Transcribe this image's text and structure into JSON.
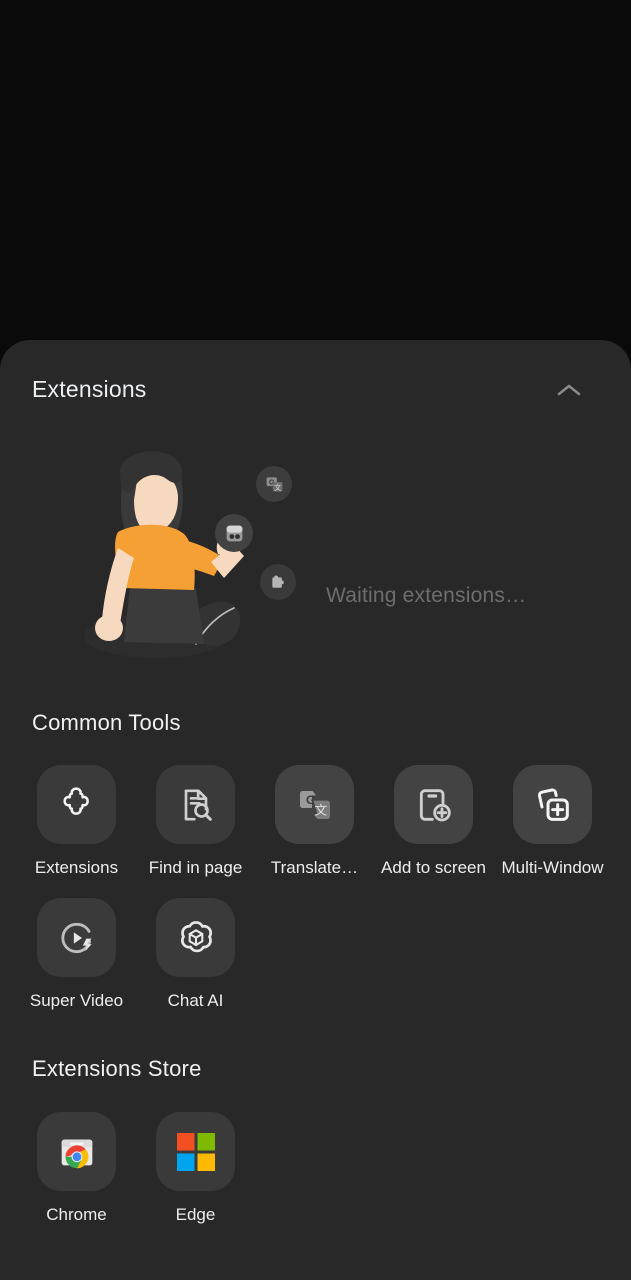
{
  "panel": {
    "extensions_header": {
      "title": "Extensions",
      "collapse_icon": "chevron-up-icon"
    },
    "illustration": {
      "alt": "person-reaching-for-extension-icons",
      "status_text": "Waiting extensions…",
      "floating_icons": [
        {
          "name": "translate-chip-icon"
        },
        {
          "name": "bookmark-chip-icon"
        },
        {
          "name": "puzzle-chip-icon"
        }
      ]
    },
    "common_tools": {
      "title": "Common Tools",
      "items": [
        {
          "label": "Extensions",
          "icon": "puzzle-piece-icon"
        },
        {
          "label": "Find in page",
          "icon": "document-search-icon"
        },
        {
          "label": "Translate…",
          "icon": "google-translate-icon"
        },
        {
          "label": "Add to screen",
          "icon": "add-to-home-screen-icon"
        },
        {
          "label": "Multi-Window",
          "icon": "multi-window-add-icon"
        },
        {
          "label": "Super Video",
          "icon": "video-boost-icon"
        },
        {
          "label": "Chat AI",
          "icon": "openai-logo-icon"
        }
      ]
    },
    "extensions_store": {
      "title": "Extensions Store",
      "items": [
        {
          "label": "Chrome",
          "icon": "chrome-web-store-icon"
        },
        {
          "label": "Edge",
          "icon": "microsoft-logo-icon"
        }
      ]
    }
  },
  "colors": {
    "background": "#0a0a0a",
    "sheet": "#282828",
    "tile": "#3a3a3a",
    "text_primary": "#ededed",
    "text_muted": "#6e6e6e",
    "accent_orange": "#f5a034"
  }
}
